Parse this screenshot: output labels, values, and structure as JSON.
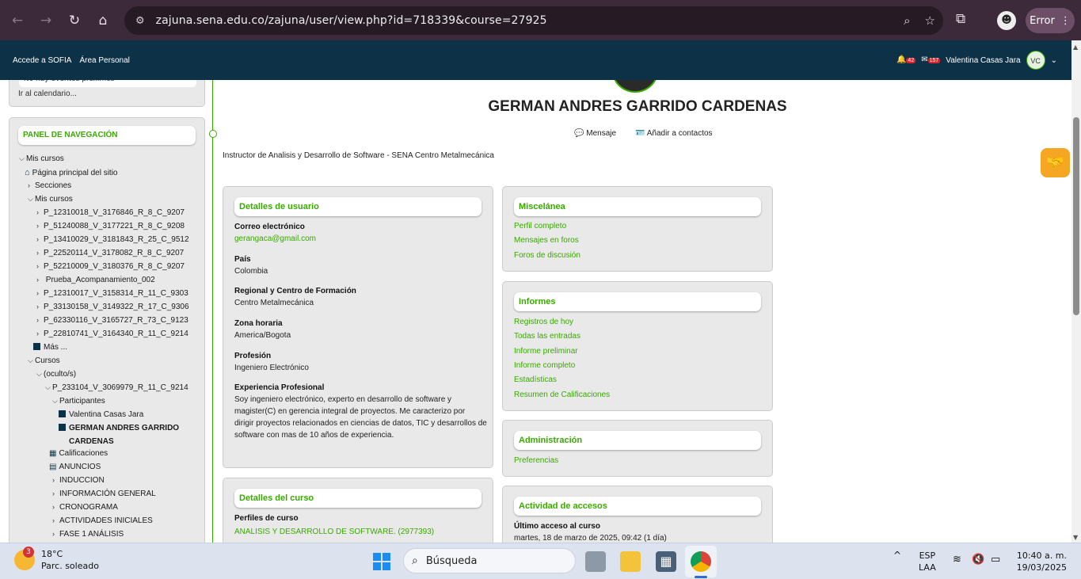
{
  "browser": {
    "url": "zajuna.sena.edu.co/zajuna/user/view.php?id=718339&course=27925",
    "error_label": "Error"
  },
  "topbar": {
    "link1": "Accede a SOFIA",
    "link2": "Área Personal",
    "notif_count": "42",
    "msg_count": "157",
    "user_name": "Valentina Casas Jara",
    "user_initials": "VC"
  },
  "sidebar": {
    "events_cut": "No hay eventos próximos",
    "calendar_link": "Ir al calendario...",
    "nav_title": "PANEL DE NAVEGACIÓN",
    "items": [
      "Mis cursos",
      "Página principal del sitio",
      "Secciones",
      "Mis cursos",
      "P_12310018_V_3176846_R_8_C_9207",
      "P_51240088_V_3177221_R_8_C_9208",
      "P_13410029_V_3181843_R_25_C_9512",
      "P_22520114_V_3178082_R_8_C_9207",
      "P_52210009_V_3180376_R_8_C_9207",
      "Prueba_Acompanamiento_002",
      "P_12310017_V_3158314_R_11_C_9303",
      "P_33130158_V_3149322_R_17_C_9306",
      "P_62330116_V_3165727_R_73_C_9123",
      "P_22810741_V_3164340_R_11_C_9214",
      "Más ...",
      "Cursos",
      "(oculto/s)",
      "P_233104_V_3069979_R_11_C_9214",
      "Participantes",
      "Valentina Casas Jara",
      "GERMAN ANDRES GARRIDO",
      "CARDENAS",
      "Calificaciones",
      "ANUNCIOS",
      "INDUCCION",
      "INFORMACIÓN GENERAL",
      "CRONOGRAMA",
      "ACTIVIDADES INICIALES",
      "FASE 1 ANÁLISIS"
    ]
  },
  "profile": {
    "name": "GERMAN ANDRES GARRIDO CARDENAS",
    "message": "Mensaje",
    "add_contact": "Añadir a contactos",
    "description": "Instructor de Analisis y Desarrollo de Software - SENA Centro Metalmecánica"
  },
  "user_details": {
    "title": "Detalles de usuario",
    "email_label": "Correo electrónico",
    "email": "gerangaca@gmail.com",
    "country_label": "País",
    "country": "Colombia",
    "regional_label": "Regional y Centro de Formación",
    "regional": "Centro Metalmecánica",
    "tz_label": "Zona horaria",
    "tz": "America/Bogota",
    "prof_label": "Profesión",
    "prof": "Ingeniero Electrónico",
    "exp_label": "Experiencia Profesional",
    "exp1": "Soy ingeniero electrónico, experto en desarrollo de software y",
    "exp2": "magister(C) en gerencia integral de proyectos. Me caracterizo por",
    "exp3": "dirigir proyectos relacionados en ciencias de datos, TIC y desarrollos de",
    "exp4": "software con mas de 10 años de experiencia."
  },
  "course_details": {
    "title": "Detalles del curso",
    "profiles_label": "Perfiles de curso",
    "profile_link": "ANALISIS Y DESARROLLO DE SOFTWARE. (2977393)"
  },
  "misc": {
    "title": "Miscelánea",
    "links": [
      "Perfil completo",
      "Mensajes en foros",
      "Foros de discusión"
    ]
  },
  "reports": {
    "title": "Informes",
    "links": [
      "Registros de hoy",
      "Todas las entradas",
      "Informe preliminar",
      "Informe completo",
      "Estadísticas",
      "Resumen de Calificaciones"
    ]
  },
  "admin": {
    "title": "Administración",
    "links": [
      "Preferencias"
    ]
  },
  "access": {
    "title": "Actividad de accesos",
    "last_label": "Último acceso al curso",
    "last_value": "martes, 18 de marzo de 2025, 09:42  (1 día)"
  },
  "taskbar": {
    "temp": "18°C",
    "weather": "Parc. soleado",
    "weather_badge": "3",
    "search": "Búsqueda",
    "lang1": "ESP",
    "lang2": "LAA",
    "time": "10:40 a. m.",
    "date": "19/03/2025"
  }
}
